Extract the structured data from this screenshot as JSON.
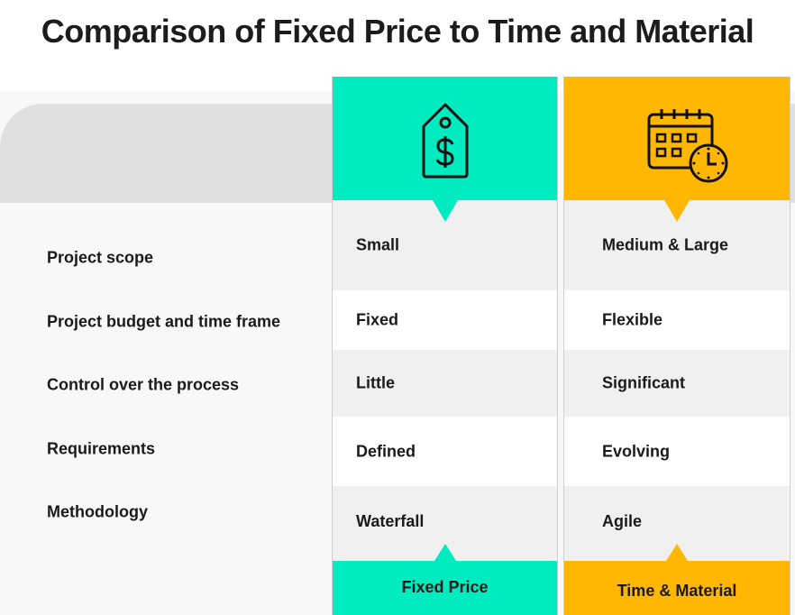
{
  "title": "Comparison of Fixed Price to Time and Material",
  "colors": {
    "fixed_price": "#00ebc0",
    "time_material": "#ffb703",
    "header_gray": "#e0e0e0",
    "row_gray": "#f0f0f0"
  },
  "rows": [
    {
      "label": "Project scope"
    },
    {
      "label": "Project budget and time frame"
    },
    {
      "label": "Control over the process"
    },
    {
      "label": "Requirements"
    },
    {
      "label": "Methodology"
    }
  ],
  "columns": [
    {
      "name": "Fixed Price",
      "icon": "price-tag-dollar-icon",
      "values": [
        "Small",
        "Fixed",
        "Little",
        "Defined",
        "Waterfall"
      ]
    },
    {
      "name": "Time & Material",
      "icon": "calendar-clock-icon",
      "values": [
        "Medium & Large",
        "Flexible",
        "Significant",
        "Evolving",
        "Agile"
      ]
    }
  ]
}
